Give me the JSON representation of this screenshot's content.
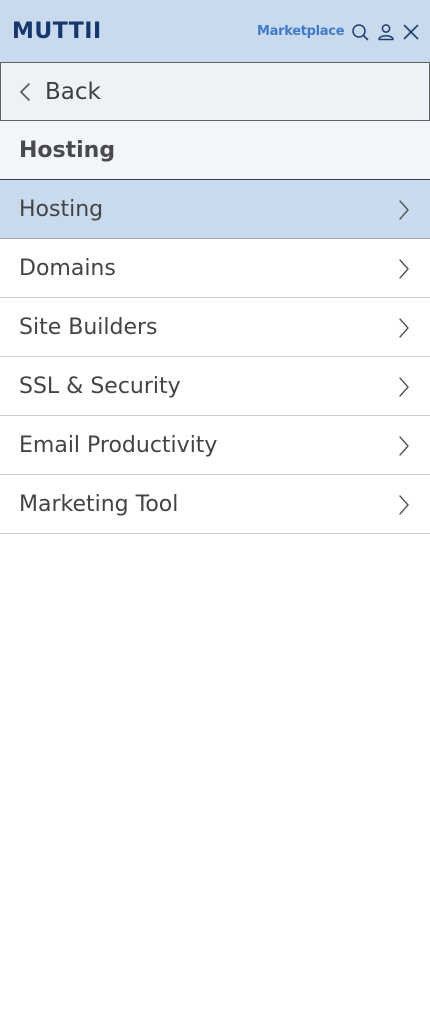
{
  "header": {
    "logo": "MUTTII",
    "marketplace_link": "Marketplace",
    "icons": [
      "search-icon",
      "user-icon",
      "close-icon"
    ],
    "background": "#c9daee",
    "accent": "#3f7bc7",
    "logo_color": "#16376b"
  },
  "back": {
    "label": "Back",
    "icon": "chevron-left-icon"
  },
  "section": {
    "title": "Hosting"
  },
  "menu": {
    "items": [
      {
        "label": "Hosting",
        "active": true
      },
      {
        "label": "Domains",
        "active": false
      },
      {
        "label": "Site Builders",
        "active": false
      },
      {
        "label": "SSL & Security",
        "active": false
      },
      {
        "label": "Email Productivity",
        "active": false
      },
      {
        "label": "Marketing Tool",
        "active": false
      }
    ],
    "item_icon": "chevron-right-icon",
    "active_color": "#c9daee"
  }
}
